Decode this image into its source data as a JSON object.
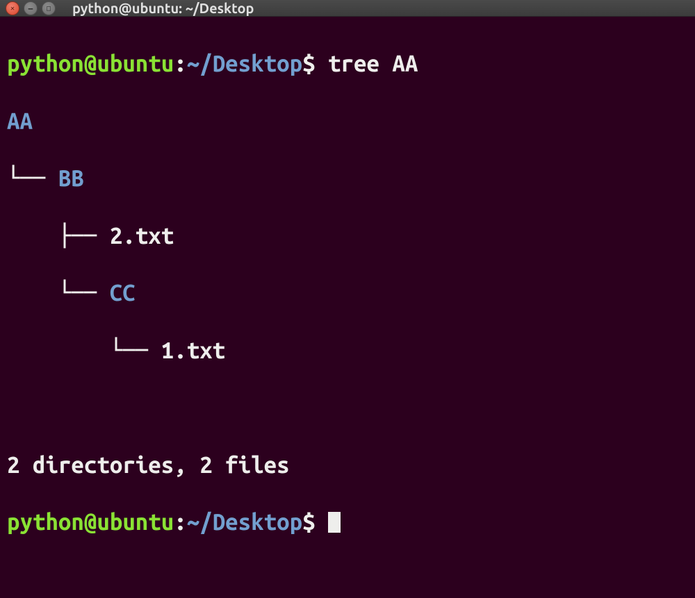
{
  "titlebar": {
    "title": "python@ubuntu: ~/Desktop"
  },
  "prompt1": {
    "user_host": "python@ubuntu",
    "colon": ":",
    "path": "~/Desktop",
    "sigil": "$ ",
    "command": "tree AA"
  },
  "tree": {
    "root": "AA",
    "l1_branch": "└── ",
    "l1_dir": "BB",
    "l2_branch1": "    ├── ",
    "l2_file1": "2.txt",
    "l2_branch2": "    └── ",
    "l2_dir": "CC",
    "l3_branch": "        └── ",
    "l3_file": "1.txt"
  },
  "summary": "2 directories, 2 files",
  "prompt2": {
    "user_host": "python@ubuntu",
    "colon": ":",
    "path": "~/Desktop",
    "sigil": "$ "
  }
}
